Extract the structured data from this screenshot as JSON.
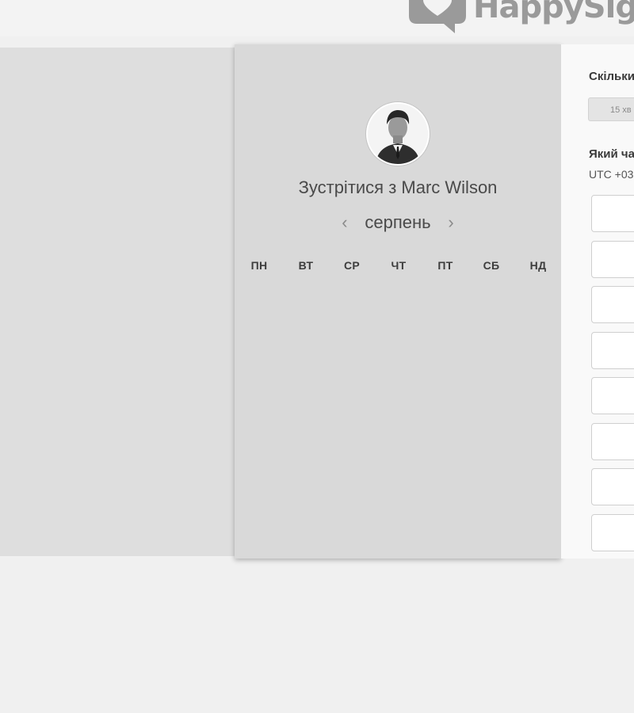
{
  "brand": {
    "name": "HappySig",
    "logo_icon": "speech-bubble-heart-icon"
  },
  "booking": {
    "title": "Зустрітися з Marc Wilson",
    "host_avatar": "avatar-photo",
    "month": "серпень",
    "prev_arrow": "‹",
    "next_arrow": "›",
    "weekdays": [
      "ПН",
      "ВТ",
      "СР",
      "ЧТ",
      "ПТ",
      "СБ",
      "НД"
    ]
  },
  "side_panel": {
    "duration_heading": "Скільки",
    "duration_option": "15 хв",
    "time_heading": "Який ча",
    "timezone": "UTC +03",
    "slots_count": 8
  },
  "colors": {
    "page_bg": "#f0f0f0",
    "card_bg": "#d9d9d9",
    "panel_bg": "#f9f9f9",
    "logo_gray": "#9a9a9a"
  }
}
